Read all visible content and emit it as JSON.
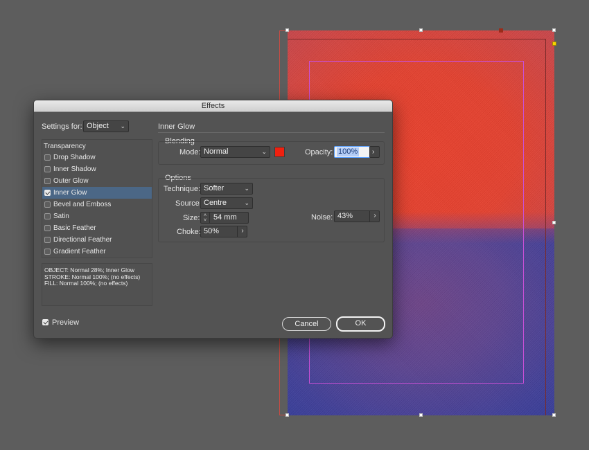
{
  "dialog": {
    "title": "Effects",
    "settings_for_label": "Settings for:",
    "settings_for_value": "Object",
    "section_title": "Inner Glow",
    "list_header": "Transparency",
    "effects": [
      {
        "label": "Drop Shadow",
        "checked": false,
        "selected": false
      },
      {
        "label": "Inner Shadow",
        "checked": false,
        "selected": false
      },
      {
        "label": "Outer Glow",
        "checked": false,
        "selected": false
      },
      {
        "label": "Inner Glow",
        "checked": true,
        "selected": true
      },
      {
        "label": "Bevel and Emboss",
        "checked": false,
        "selected": false
      },
      {
        "label": "Satin",
        "checked": false,
        "selected": false
      },
      {
        "label": "Basic Feather",
        "checked": false,
        "selected": false
      },
      {
        "label": "Directional Feather",
        "checked": false,
        "selected": false
      },
      {
        "label": "Gradient Feather",
        "checked": false,
        "selected": false
      }
    ],
    "summary": [
      "OBJECT: Normal 28%; Inner Glow",
      "STROKE: Normal 100%; (no effects)",
      "FILL: Normal 100%; (no effects)"
    ],
    "blending": {
      "title": "Blending",
      "mode_label": "Mode:",
      "mode_value": "Normal",
      "swatch_color": "#f0200f",
      "opacity_label": "Opacity:",
      "opacity_value": "100%"
    },
    "options": {
      "title": "Options",
      "technique_label": "Technique:",
      "technique_value": "Softer",
      "source_label": "Source:",
      "source_value": "Centre",
      "size_label": "Size:",
      "size_value": "54 mm",
      "choke_label": "Choke:",
      "choke_value": "50%",
      "noise_label": "Noise:",
      "noise_value": "43%"
    },
    "preview_label": "Preview",
    "preview_checked": true,
    "cancel_label": "Cancel",
    "ok_label": "OK"
  },
  "colors": {
    "canvas_bg": "#5d5d5d",
    "artwork_top": "#e3412f",
    "artwork_bottom": "#3d3e98",
    "margin_guide": "#c94fd6",
    "selection_highlight": "#4b6786"
  }
}
